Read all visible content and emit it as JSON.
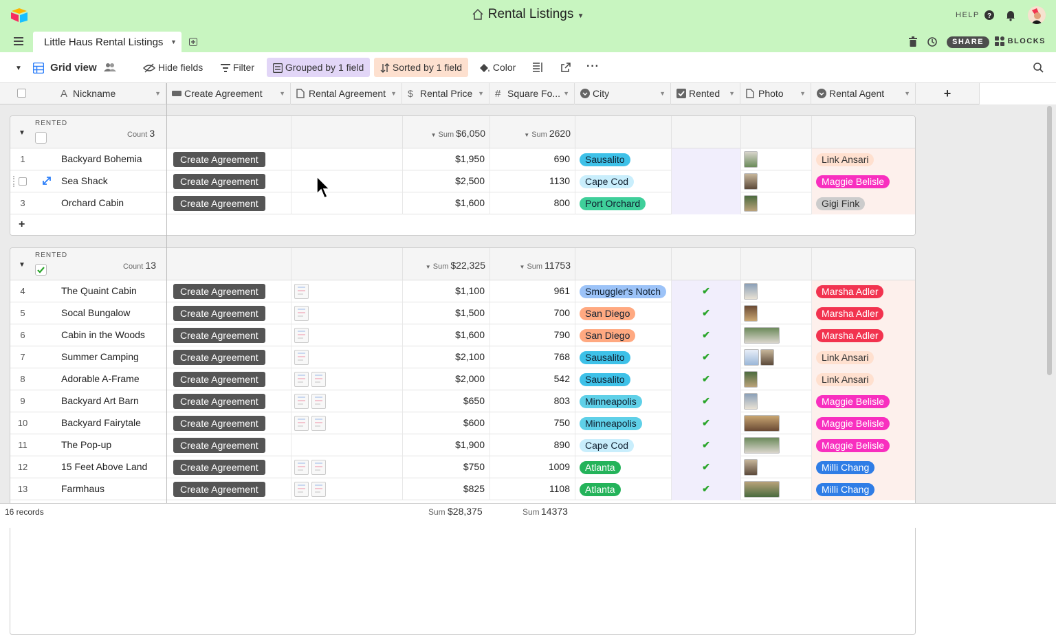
{
  "app": {
    "base_title": "Rental Listings",
    "help_label": "HELP",
    "table_tab": "Little Haus Rental Listings",
    "share_label": "SHARE",
    "blocks_label": "BLOCKS"
  },
  "viewbar": {
    "view_name": "Grid view",
    "hide_fields": "Hide fields",
    "filter": "Filter",
    "grouped": "Grouped by 1 field",
    "sorted": "Sorted by 1 field",
    "color": "Color"
  },
  "columns": [
    {
      "name": "Nickname",
      "icon": "text-field-icon"
    },
    {
      "name": "Create Agreement",
      "icon": "button-field-icon"
    },
    {
      "name": "Rental Agreement",
      "icon": "attachment-field-icon"
    },
    {
      "name": "Rental Price",
      "icon": "currency-field-icon"
    },
    {
      "name": "Square Fo...",
      "icon": "number-field-icon"
    },
    {
      "name": "City",
      "icon": "single-select-field-icon"
    },
    {
      "name": "Rented",
      "icon": "checkbox-field-icon"
    },
    {
      "name": "Photo",
      "icon": "attachment-field-icon"
    },
    {
      "name": "Rental Agent",
      "icon": "single-select-field-icon"
    }
  ],
  "groups": [
    {
      "label": "RENTED",
      "checked": false,
      "count_label": "Count",
      "count": "3",
      "sum_label": "Sum",
      "price_sum": "$6,050",
      "sqft_sum": "2620",
      "rows": [
        {
          "num": "1",
          "nickname": "Backyard Bohemia",
          "button": "Create Agreement",
          "agreements": 0,
          "price": "$1,950",
          "sqft": "690",
          "city": "Sausalito",
          "rented": false,
          "photos": 1,
          "agent": "Link Ansari"
        },
        {
          "num": "",
          "nickname": "Sea Shack",
          "button": "Create Agreement",
          "agreements": 0,
          "price": "$2,500",
          "sqft": "1130",
          "city": "Cape Cod",
          "rented": false,
          "photos": 1,
          "agent": "Maggie Belisle"
        },
        {
          "num": "3",
          "nickname": "Orchard Cabin",
          "button": "Create Agreement",
          "agreements": 0,
          "price": "$1,600",
          "sqft": "800",
          "city": "Port Orchard",
          "rented": false,
          "photos": 1,
          "agent": "Gigi Fink"
        }
      ],
      "add_row": "+"
    },
    {
      "label": "RENTED",
      "checked": true,
      "count_label": "Count",
      "count": "13",
      "sum_label": "Sum",
      "price_sum": "$22,325",
      "sqft_sum": "11753",
      "rows": [
        {
          "num": "4",
          "nickname": "The Quaint Cabin",
          "button": "Create Agreement",
          "agreements": 1,
          "price": "$1,100",
          "sqft": "961",
          "city": "Smuggler's Notch",
          "rented": true,
          "photos": 1,
          "agent": "Marsha Adler"
        },
        {
          "num": "5",
          "nickname": "Socal Bungalow",
          "button": "Create Agreement",
          "agreements": 1,
          "price": "$1,500",
          "sqft": "700",
          "city": "San Diego",
          "rented": true,
          "photos": 1,
          "agent": "Marsha Adler"
        },
        {
          "num": "6",
          "nickname": "Cabin in the Woods",
          "button": "Create Agreement",
          "agreements": 1,
          "price": "$1,600",
          "sqft": "790",
          "city": "San Diego",
          "rented": true,
          "photos": 2,
          "agent": "Marsha Adler"
        },
        {
          "num": "7",
          "nickname": "Summer Camping",
          "button": "Create Agreement",
          "agreements": 1,
          "price": "$2,100",
          "sqft": "768",
          "city": "Sausalito",
          "rented": true,
          "photos": 3,
          "agent": "Link Ansari"
        },
        {
          "num": "8",
          "nickname": "Adorable A-Frame",
          "button": "Create Agreement",
          "agreements": 2,
          "price": "$2,000",
          "sqft": "542",
          "city": "Sausalito",
          "rented": true,
          "photos": 1,
          "agent": "Link Ansari"
        },
        {
          "num": "9",
          "nickname": "Backyard Art Barn",
          "button": "Create Agreement",
          "agreements": 2,
          "price": "$650",
          "sqft": "803",
          "city": "Minneapolis",
          "rented": true,
          "photos": 1,
          "agent": "Maggie Belisle"
        },
        {
          "num": "10",
          "nickname": "Backyard Fairytale",
          "button": "Create Agreement",
          "agreements": 2,
          "price": "$600",
          "sqft": "750",
          "city": "Minneapolis",
          "rented": true,
          "photos": 2,
          "agent": "Maggie Belisle"
        },
        {
          "num": "11",
          "nickname": "The Pop-up",
          "button": "Create Agreement",
          "agreements": 0,
          "price": "$1,900",
          "sqft": "890",
          "city": "Cape Cod",
          "rented": true,
          "photos": 2,
          "agent": "Maggie Belisle"
        },
        {
          "num": "12",
          "nickname": "15 Feet Above Land",
          "button": "Create Agreement",
          "agreements": 2,
          "price": "$750",
          "sqft": "1009",
          "city": "Atlanta",
          "rented": true,
          "photos": 1,
          "agent": "Milli Chang"
        },
        {
          "num": "13",
          "nickname": "Farmhaus",
          "button": "Create Agreement",
          "agreements": 2,
          "price": "$825",
          "sqft": "1108",
          "city": "Atlanta",
          "rented": true,
          "photos": 2,
          "agent": "Milli Chang"
        }
      ]
    }
  ],
  "city_colors": {
    "Sausalito": "#3ec1e8",
    "Cape Cod": "#c9eefc",
    "Port Orchard": "#3fcf9a",
    "Smuggler's Notch": "#9cc3f8",
    "San Diego": "#ffa981",
    "Minneapolis": "#5fd0e8",
    "Atlanta": "#24b35a"
  },
  "agent_colors": {
    "Link Ansari": "#ffe0cf",
    "Maggie Belisle": "#f82fbf",
    "Gigi Fink": "#cccccc",
    "Marsha Adler": "#f2334f",
    "Milli Chang": "#2f7de6"
  },
  "footer": {
    "records": "16 records",
    "sum_label": "Sum",
    "price_total": "$28,375",
    "sqft_total": "14373"
  }
}
